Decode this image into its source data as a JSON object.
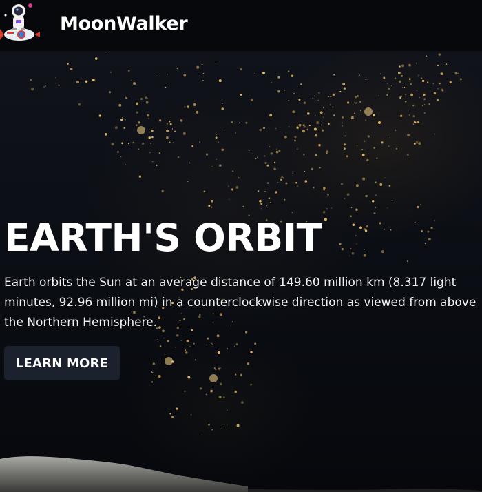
{
  "header": {
    "brand": "MoonWalker",
    "logo_icon": "astronaut-on-rocket-icon"
  },
  "hero": {
    "title": "EARTH'S ORBIT",
    "description": "Earth orbits the Sun at an average distance of 149.60 million km (8.317 light minutes, 92.96 million mi) in a counterclockwise direction as viewed from above the Northern Hemisphere.",
    "cta_label": "LEARN MORE",
    "background": "earth-night-lights-from-space-image"
  },
  "colors": {
    "navbar_bg": "#06080c",
    "button_bg": "#1c222d",
    "city_light": "#f3c46a"
  }
}
